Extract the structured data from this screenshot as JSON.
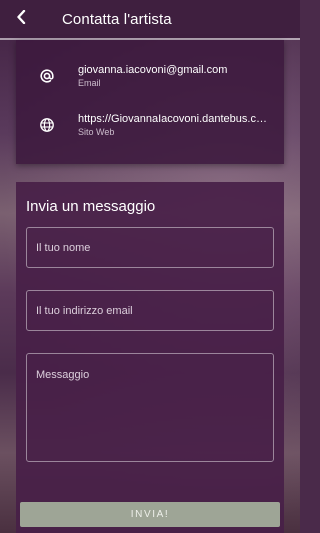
{
  "header": {
    "title": "Contatta l'artista",
    "back_icon": "arrow-left-icon"
  },
  "contacts": [
    {
      "icon": "at-icon",
      "value": "giovanna.iacovoni@gmail.com",
      "label": "Email"
    },
    {
      "icon": "globe-icon",
      "value": "https://GiovannaIacovoni.dantebus.com",
      "label": "Sito Web"
    }
  ],
  "message_form": {
    "title": "Invia un messaggio",
    "name_placeholder": "Il tuo nome",
    "email_placeholder": "Il tuo indirizzo email",
    "message_placeholder": "Messaggio",
    "send_label": "INVIA!"
  },
  "colors": {
    "header_bg": "#3f1f3f",
    "card_bg": "#482048",
    "button_bg": "#9ea596"
  }
}
